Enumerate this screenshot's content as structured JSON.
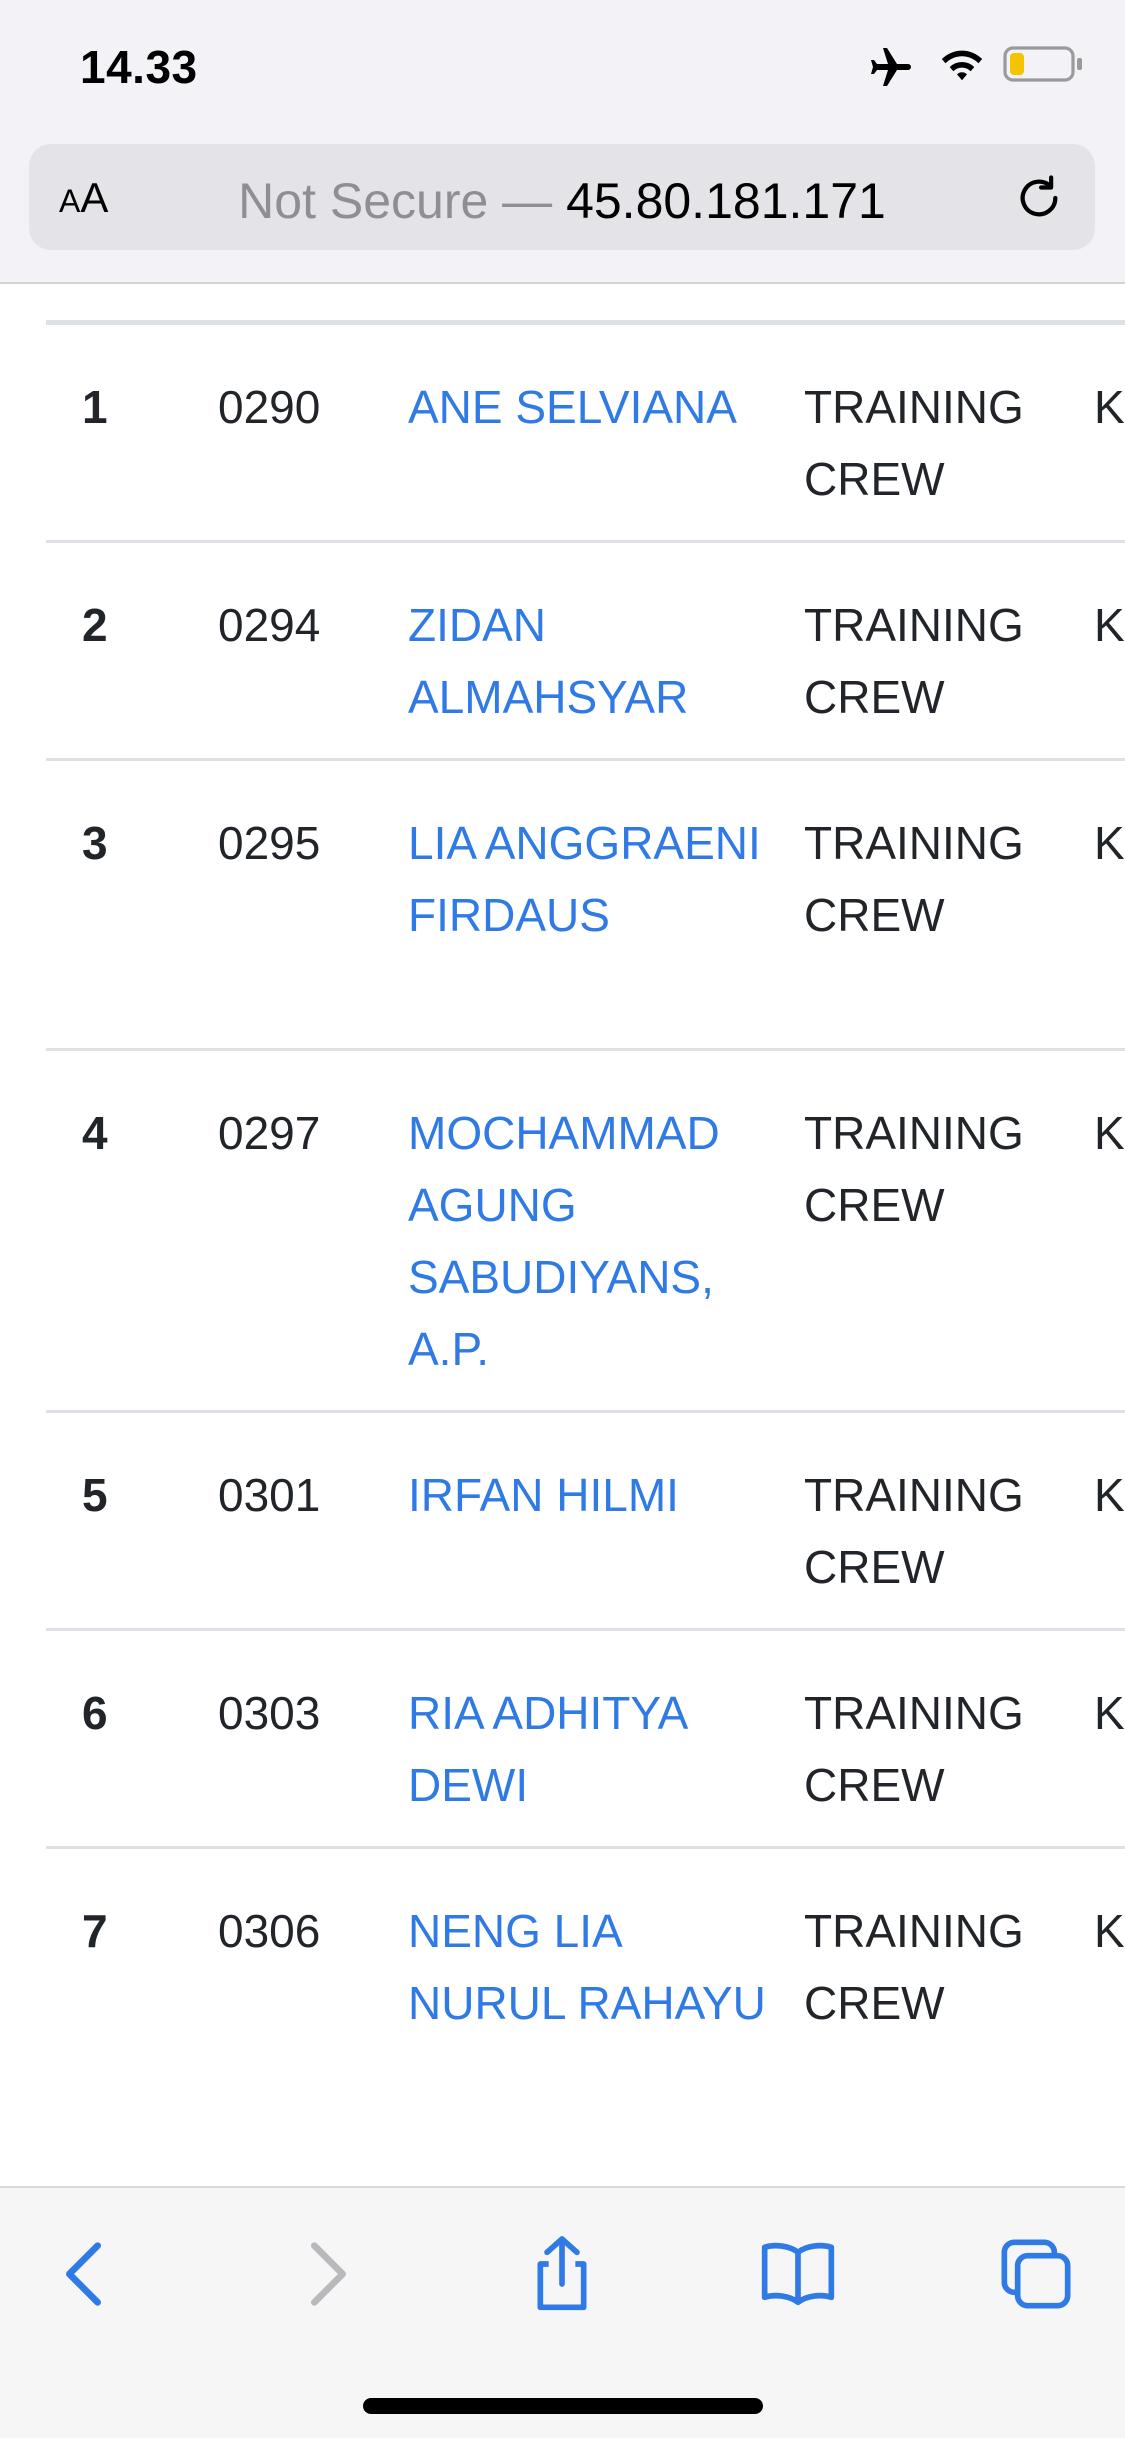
{
  "status_bar": {
    "time": "14.33",
    "icons": [
      "airplane-icon",
      "wifi-icon",
      "battery-icon"
    ]
  },
  "address_bar": {
    "text_size_label_small": "A",
    "text_size_label_large": "A",
    "security_text": "Not Secure — ",
    "host": "45.80.181.171"
  },
  "table": {
    "rows": [
      {
        "no": "1",
        "code": "0290",
        "name": "ANE SELVIANA",
        "position": "TRAINING CREW",
        "next": "K"
      },
      {
        "no": "2",
        "code": "0294",
        "name": "ZIDAN ALMAHSYAR",
        "position": "TRAINING CREW",
        "next": "K"
      },
      {
        "no": "3",
        "code": "0295",
        "name": "LIA ANGGRAENI FIRDAUS",
        "position": "TRAINING CREW",
        "next": "K"
      },
      {
        "no": "4",
        "code": "0297",
        "name": "MOCHAMMAD AGUNG SABUDIYANS, A.P.",
        "position": "TRAINING CREW",
        "next": "K"
      },
      {
        "no": "5",
        "code": "0301",
        "name": "IRFAN HILMI",
        "position": "TRAINING CREW",
        "next": "K"
      },
      {
        "no": "6",
        "code": "0303",
        "name": "RIA ADHITYA DEWI",
        "position": "TRAINING CREW",
        "next": "K"
      },
      {
        "no": "7",
        "code": "0306",
        "name": "NENG LIA NURUL RAHAYU",
        "position": "TRAINING CREW",
        "next": "K"
      }
    ]
  },
  "toolbar": {
    "icons": [
      "back-icon",
      "forward-icon",
      "share-icon",
      "bookmarks-icon",
      "tabs-icon"
    ],
    "link_color": "#2f7ae5"
  }
}
